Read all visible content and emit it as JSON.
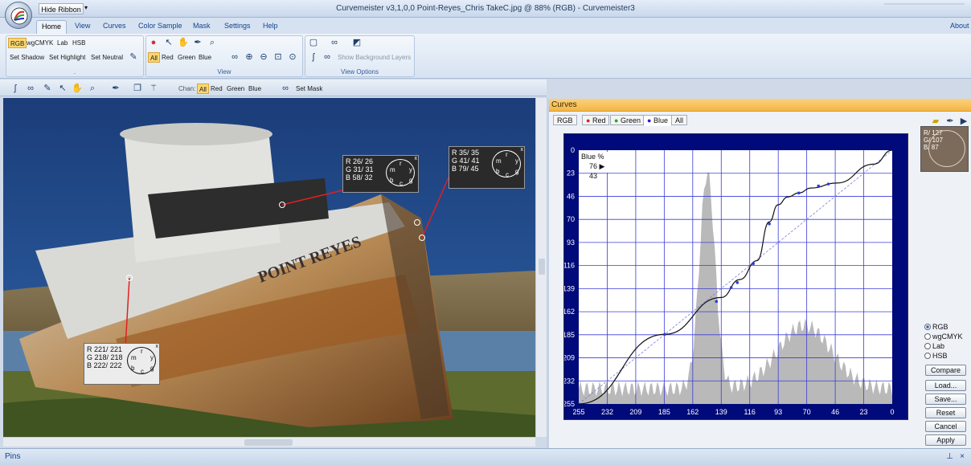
{
  "window": {
    "title": "Curvemeister v3,1,0,0        Point-Reyes_Chris TakeC.jpg @ 88% (RGB) - Curvemeister3",
    "hide_ribbon": "Hide Ribbon",
    "qat_dropdown": "▾"
  },
  "ribbon_tabs": [
    "Home",
    "View",
    "Curves",
    "Color Sample",
    "Mask",
    "Settings",
    "Help"
  ],
  "about": "About",
  "ribbon": {
    "group1": {
      "modes": [
        "RGB",
        "wgCMYK",
        "Lab",
        "HSB"
      ],
      "buttons": [
        "Set Shadow",
        "Set Highlight",
        "Set Neutral"
      ],
      "label": "."
    },
    "view": {
      "channels": [
        "All",
        "Red",
        "Green",
        "Blue"
      ],
      "label": "View"
    },
    "view_options": {
      "show_bg": "Show Background Layers",
      "label": "View Options"
    }
  },
  "toolbar2": {
    "chan_label": "Chan:",
    "channels": [
      "All",
      "Red",
      "Green",
      "Blue"
    ],
    "set_mask": "Set Mask"
  },
  "probes": [
    {
      "r": "R  26/  26",
      "g": "G  31/  31",
      "b": "B  58/  32"
    },
    {
      "r": "R  35/  35",
      "g": "G  41/  41",
      "b": "B  79/  45"
    },
    {
      "r": "R 221/ 221",
      "g": "G 218/ 218",
      "b": "B 222/ 222"
    }
  ],
  "dial_letters": [
    "r",
    "y",
    "g",
    "c",
    "b",
    "m"
  ],
  "probe_close": "x",
  "boat_lettering": "POINT REYES",
  "curves": {
    "header": "Curves",
    "tabs": [
      "RGB",
      "Red",
      "Green",
      "Blue",
      "All"
    ],
    "selected_tab": "Blue",
    "readout_title": "Blue %",
    "readout_value": "76 ▶ 43",
    "y_ticks": [
      "0",
      "23",
      "46",
      "70",
      "93",
      "116",
      "139",
      "162",
      "185",
      "209",
      "232",
      "255"
    ],
    "x_ticks": [
      "255",
      "232",
      "209",
      "185",
      "162",
      "139",
      "116",
      "93",
      "70",
      "46",
      "23",
      "0"
    ],
    "curve_points": [
      [
        255,
        255
      ],
      [
        185,
        185
      ],
      [
        139,
        148
      ],
      [
        124,
        130
      ],
      [
        110,
        111
      ],
      [
        100,
        72
      ],
      [
        93,
        55
      ],
      [
        85,
        47
      ],
      [
        76,
        43
      ],
      [
        66,
        38
      ],
      [
        45,
        33
      ],
      [
        15,
        14
      ],
      [
        0,
        0
      ]
    ],
    "control_points": [
      [
        185,
        185
      ],
      [
        143,
        152
      ],
      [
        131,
        138
      ],
      [
        126,
        133
      ],
      [
        113,
        114
      ],
      [
        100,
        74
      ],
      [
        76,
        43
      ],
      [
        60,
        36
      ],
      [
        52,
        34
      ]
    ]
  },
  "sample": {
    "r": "R/ 127",
    "g": "G/ 107",
    "b": "B/  87"
  },
  "color_modes": [
    "RGB",
    "wgCMYK",
    "Lab",
    "HSB"
  ],
  "selected_mode": "RGB",
  "buttons": [
    "Compare",
    "Load...",
    "Save...",
    "Reset",
    "Cancel",
    "Apply"
  ],
  "pins": "Pins",
  "colors": {
    "accent": "#f4b547",
    "ribbon": "#d7e3f2",
    "graph_bg": "#000a7a",
    "grid": "#3b3bd8"
  }
}
